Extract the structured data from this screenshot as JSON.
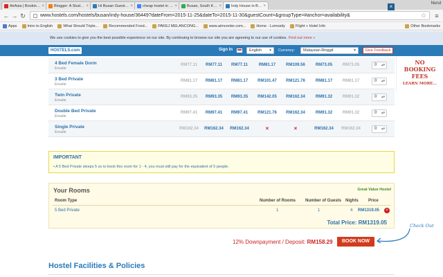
{
  "browser": {
    "tabs": [
      {
        "label": "AirAsia | Booking | Book in...",
        "color": "#e02020"
      },
      {
        "label": "Blogger: A Student, A Tra...",
        "color": "#f57d00"
      },
      {
        "label": "Hi Busan Guest House in B...",
        "color": "#2a7ab8"
      },
      {
        "label": "cheap hostel in busan - G...",
        "color": "#4285f4"
      },
      {
        "label": "Busan, South Korea - Acti...",
        "color": "#34a853"
      },
      {
        "label": "Indy House in Busan, Sou...",
        "color": "#2a7ab8"
      }
    ],
    "user": "Nurul",
    "url": "www.hostels.com/hostels/busan/indy-house/36449?dateFrom=2015-11-25&dateTo=2015-11-30&guestCount=&groupType=#anchor=availability&",
    "bookmarks": [
      "Apps",
      "Intro to English",
      "What Should Triple...",
      "Recommended Food...",
      "PAKEJ MELANCONG...",
      "www.aimcenter.com...",
      "Home - Lumosity",
      "Flight + Hotel Info"
    ],
    "other_bookmarks": "Other Bookmarks"
  },
  "cookie": {
    "text": "We use cookies to give you the best possible experience on our site. By continuing to browse our site you are agreeing to our use of cookies.",
    "link": "Find out more »",
    "close": "×"
  },
  "site": {
    "logo": "HOSTELS.com",
    "signin": "Sign In",
    "language": "English",
    "currency_label": "Currency:",
    "currency": "Malaysian Ringgit",
    "feedback": "Give Feedback"
  },
  "rooms": [
    {
      "name": "4 Bed Female Dorm",
      "sub": "Ensuite",
      "prices": [
        {
          "v": "RM77.11",
          "m": true
        },
        {
          "v": "RM77.11",
          "m": false
        },
        {
          "v": "RM77.11",
          "m": false
        },
        {
          "v": "RM81.17",
          "m": false
        },
        {
          "v": "RM109.56",
          "m": false
        },
        {
          "v": "RM73.05",
          "m": false
        },
        {
          "v": "RM73.05",
          "m": true
        }
      ],
      "qty": "0"
    },
    {
      "name": "3 Bed Private",
      "sub": "Ensuite",
      "prices": [
        {
          "v": "RM81.17",
          "m": true
        },
        {
          "v": "RM81.17",
          "m": false
        },
        {
          "v": "RM81.17",
          "m": false
        },
        {
          "v": "RM101.47",
          "m": false
        },
        {
          "v": "RM121.76",
          "m": false
        },
        {
          "v": "RM81.17",
          "m": false
        },
        {
          "v": "RM81.17",
          "m": true
        }
      ],
      "qty": "0"
    },
    {
      "name": "Twin Private",
      "sub": "Ensuite",
      "prices": [
        {
          "v": "RM93.35",
          "m": true
        },
        {
          "v": "RM93.35",
          "m": false
        },
        {
          "v": "RM93.35",
          "m": false
        },
        {
          "v": "RM142.05",
          "m": false
        },
        {
          "v": "RM162.34",
          "m": false
        },
        {
          "v": "RM91.32",
          "m": false
        },
        {
          "v": "RM91.32",
          "m": true
        }
      ],
      "qty": "0"
    },
    {
      "name": "Double Bed Private",
      "sub": "Ensuite",
      "prices": [
        {
          "v": "RM97.41",
          "m": true
        },
        {
          "v": "RM97.41",
          "m": false
        },
        {
          "v": "RM97.41",
          "m": false
        },
        {
          "v": "RM121.76",
          "m": false
        },
        {
          "v": "RM162.34",
          "m": false
        },
        {
          "v": "RM91.32",
          "m": false
        },
        {
          "v": "RM91.32",
          "m": true
        }
      ],
      "qty": "0"
    },
    {
      "name": "Single Private",
      "sub": "Ensuite",
      "prices": [
        {
          "v": "RM162.34",
          "m": true
        },
        {
          "v": "RM162.34",
          "m": false
        },
        {
          "v": "RM162.34",
          "m": false
        },
        {
          "v": "×",
          "m": false,
          "x": true
        },
        {
          "v": "×",
          "m": false,
          "x": true
        },
        {
          "v": "RM162.34",
          "m": false
        },
        {
          "v": "RM162.34",
          "m": true
        }
      ],
      "qty": "0"
    }
  ],
  "ad": {
    "l1": "NO",
    "l2": "BOOKING",
    "l3": "FEES",
    "l4": "LEARN MORE..."
  },
  "important": {
    "title": "IMPORTANT",
    "text": "• A 5 Bed Private sleeps 5 so to book this room for 1 - 4, you must still pay for the equivalent of 5 people."
  },
  "your_rooms": {
    "title": "Your Rooms",
    "badge": "Great Value Hostel",
    "headers": {
      "type": "Room Type",
      "num_rooms": "Number of Rooms",
      "num_guests": "Number of Guests",
      "nights": "Nights",
      "price": "Price"
    },
    "item": {
      "type": "5 Bed Private",
      "num_rooms": "1",
      "num_guests": "1",
      "nights": "4",
      "price": "RM1319.05"
    },
    "total": "Total Price: RM1319.05"
  },
  "deposit": {
    "prefix": "12% Downpayment / Deposit:",
    "amount": "RM158.29"
  },
  "book_now": "BOOK NOW",
  "check_out": "Check Out",
  "facilities_title": "Hostel Facilities & Policies"
}
